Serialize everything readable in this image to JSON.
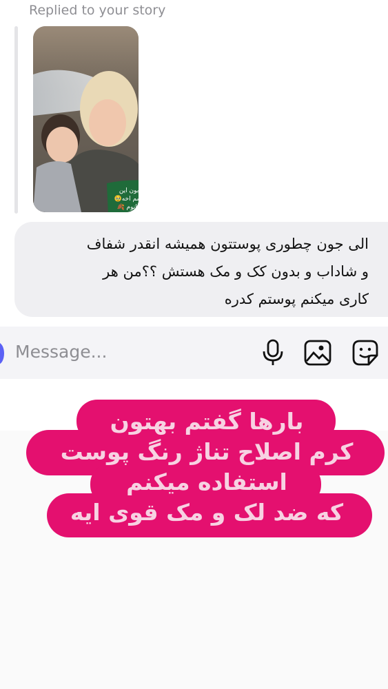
{
  "reply_header": {
    "label": "Replied to your story"
  },
  "story": {
    "sticker_text": "من قربون این\nجوجه بشم اخه🥹\nخانوم خانوم 🍂"
  },
  "message": {
    "text": "الی جون چطوری پوستتون همیشه انقدر شفاف\nو شاداب و بدون کک و مک هستش ؟؟من هر\nکاری میکنم پوستم کدره"
  },
  "composer": {
    "placeholder": "Message..."
  },
  "overlay": {
    "text": "بارها گفتم بهتون\nکرم اصلاح تناژ رنگ پوست\nاستفاده میکنم\nکه ضد لک و مک قوی ایه"
  },
  "colors": {
    "accent": "#e4106f",
    "bubble": "#efeff2",
    "composer_accent": "#5b61f5"
  },
  "icons": {
    "composer": [
      "microphone-icon",
      "gallery-icon",
      "sticker-icon"
    ]
  }
}
